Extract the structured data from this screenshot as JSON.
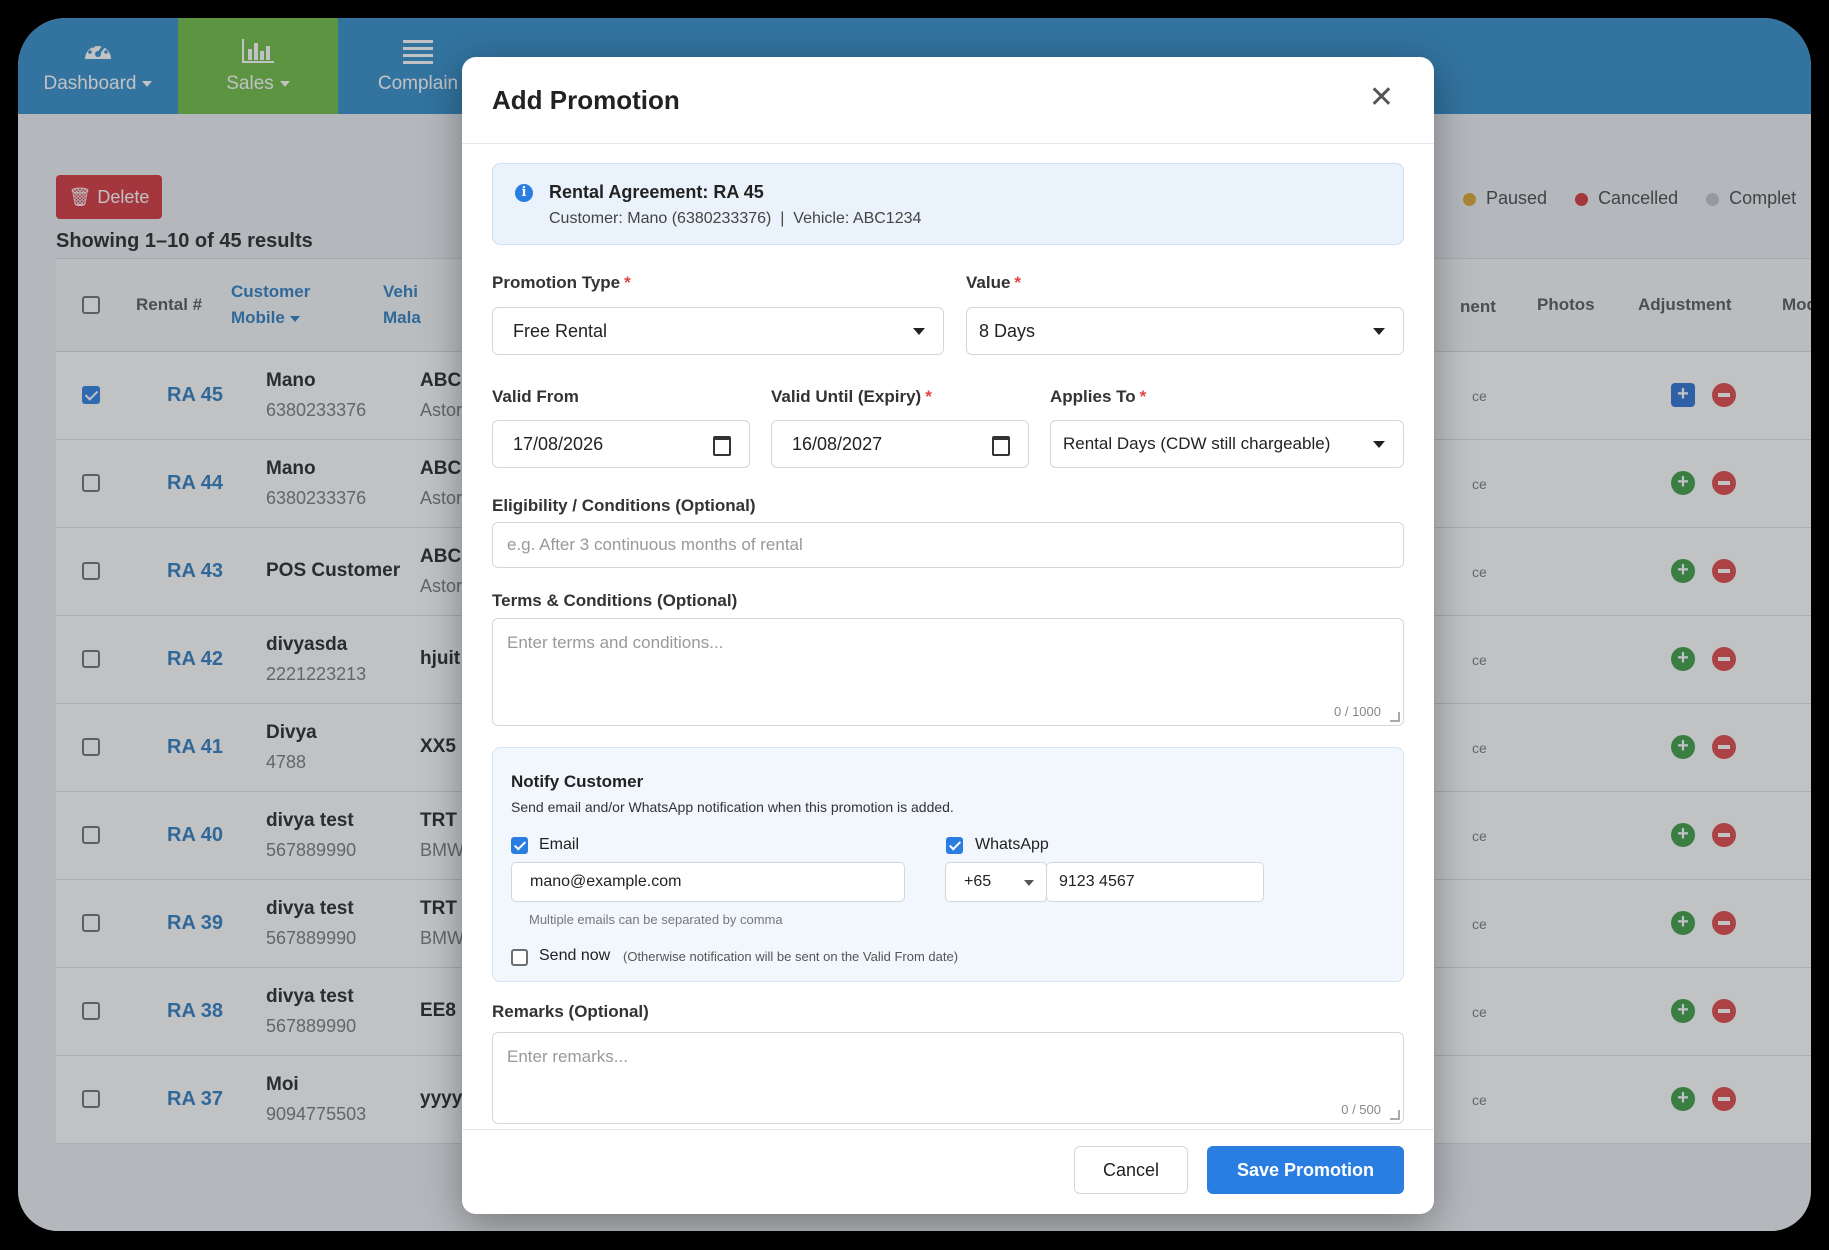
{
  "nav": {
    "items": [
      {
        "label": "Dashboard",
        "icon": "dashboard-gauge-icon"
      },
      {
        "label": "Sales",
        "icon": "bar-chart-icon"
      },
      {
        "label": "Complain",
        "icon": "list-icon"
      }
    ],
    "active_color": "#6dbb3f",
    "bar_color": "#2f8bc9"
  },
  "page": {
    "delete_label": "Delete",
    "results_text": "Showing 1–10 of 45 results",
    "legend": [
      {
        "label": "Paused",
        "color": "#e0a52a"
      },
      {
        "label": "Cancelled",
        "color": "#d6323a"
      },
      {
        "label": "Complet",
        "color": "#bfc4ca"
      }
    ],
    "columns": {
      "rental": "Rental #",
      "customer_mobile": "Customer Mobile",
      "vehicle": "Vehi Mala",
      "partial": "nent",
      "photos": "Photos",
      "adjustment": "Adjustment",
      "more": "Mod"
    },
    "rows": [
      {
        "no": "RA 45",
        "name": "Mano",
        "mobile": "6380233376",
        "veh1": "ABC",
        "veh2": "Astor",
        "misc": "ce",
        "checked": true
      },
      {
        "no": "RA 44",
        "name": "Mano",
        "mobile": "6380233376",
        "veh1": "ABC",
        "veh2": "Astor",
        "misc": "ce",
        "checked": false
      },
      {
        "no": "RA 43",
        "name": "POS Customer",
        "mobile": "",
        "veh1": "ABC",
        "veh2": "Astor",
        "misc": "ce",
        "checked": false
      },
      {
        "no": "RA 42",
        "name": "divyasda",
        "mobile": "2221223213",
        "veh1": "hjuit",
        "veh2": "",
        "misc": "ce",
        "checked": false
      },
      {
        "no": "RA 41",
        "name": "Divya",
        "mobile": "4788",
        "veh1": "XX5",
        "veh2": "",
        "misc": "ce",
        "checked": false
      },
      {
        "no": "RA 40",
        "name": "divya test",
        "mobile": "567889990",
        "veh1": "TRT",
        "veh2": "BMW",
        "misc": "ce",
        "checked": false
      },
      {
        "no": "RA 39",
        "name": "divya test",
        "mobile": "567889990",
        "veh1": "TRT",
        "veh2": "BMW",
        "misc": "ce",
        "checked": false
      },
      {
        "no": "RA 38",
        "name": "divya test",
        "mobile": "567889990",
        "veh1": "EE8",
        "veh2": "",
        "misc": "ce",
        "checked": false
      },
      {
        "no": "RA 37",
        "name": "Moi",
        "mobile": "9094775503",
        "veh1": "yyyy",
        "veh2": "",
        "misc": "ce",
        "checked": false
      }
    ]
  },
  "modal": {
    "title": "Add Promotion",
    "info": {
      "title": "Rental Agreement: RA 45",
      "subtitle": "Customer: Mano (6380233376)  |  Vehicle: ABC1234"
    },
    "promotion_type": {
      "label": "Promotion Type",
      "value": "Free Rental"
    },
    "value": {
      "label": "Value",
      "value": "8 Days"
    },
    "valid_from": {
      "label": "Valid From",
      "value": "17/08/2026"
    },
    "valid_until": {
      "label": "Valid Until (Expiry)",
      "value": "16/08/2027"
    },
    "applies_to": {
      "label": "Applies To",
      "value": "Rental Days (CDW still chargeable)"
    },
    "eligibility": {
      "label": "Eligibility / Conditions (Optional)",
      "placeholder": "e.g. After 3 continuous months of rental"
    },
    "terms": {
      "label": "Terms & Conditions (Optional)",
      "placeholder": "Enter terms and conditions...",
      "count": "0 / 1000"
    },
    "notify": {
      "title": "Notify Customer",
      "subtitle": "Send email and/or WhatsApp notification when this promotion is added.",
      "email_label": "Email",
      "email_checked": true,
      "email_value": "mano@example.com",
      "email_hint": "Multiple emails can be separated by comma",
      "whatsapp_label": "WhatsApp",
      "whatsapp_checked": true,
      "country_code": "+65",
      "phone": "9123 4567",
      "send_now_label": "Send now",
      "send_now_hint": "(Otherwise notification will be sent on the Valid From date)",
      "send_now_checked": false
    },
    "remarks": {
      "label": "Remarks (Optional)",
      "placeholder": "Enter remarks...",
      "count": "0 / 500"
    },
    "cancel_label": "Cancel",
    "save_label": "Save Promotion"
  }
}
